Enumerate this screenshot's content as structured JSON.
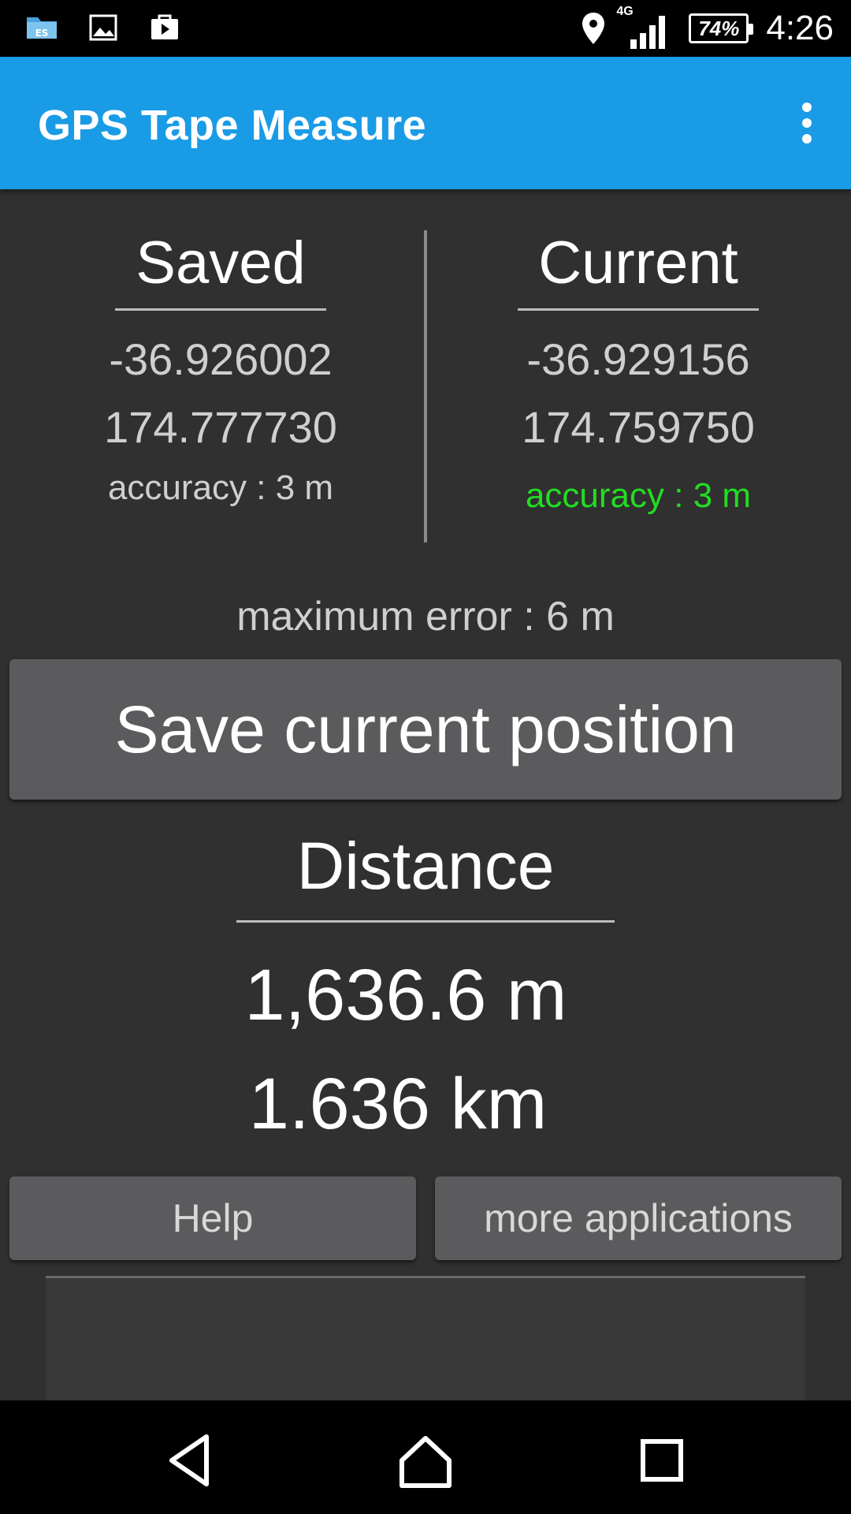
{
  "status_bar": {
    "time": "4:26",
    "battery": "74%",
    "network": "4G",
    "icons": [
      "file-explorer-icon",
      "image-icon",
      "shopping-bag-icon",
      "location-icon",
      "signal-icon",
      "battery-icon"
    ]
  },
  "app_bar": {
    "title": "GPS Tape Measure",
    "menu_icon": "overflow-menu-icon"
  },
  "saved": {
    "heading": "Saved",
    "latitude": "-36.926002",
    "longitude": "174.777730",
    "accuracy": "accuracy : 3 m"
  },
  "current": {
    "heading": "Current",
    "latitude": "-36.929156",
    "longitude": "174.759750",
    "accuracy": "accuracy : 3 m",
    "accuracy_color": "#22dd22"
  },
  "max_error": "maximum error : 6 m",
  "save_button": "Save current position",
  "distance": {
    "heading": "Distance",
    "meters": "1,636.6 m",
    "kilometers": "1.636 km"
  },
  "buttons": {
    "help": "Help",
    "more": "more applications"
  },
  "nav_bar": {
    "icons": [
      "back-icon",
      "home-icon",
      "recents-icon"
    ]
  },
  "colors": {
    "app_bar": "#1a9be6",
    "background": "#303030",
    "button": "#5b5b5d"
  }
}
